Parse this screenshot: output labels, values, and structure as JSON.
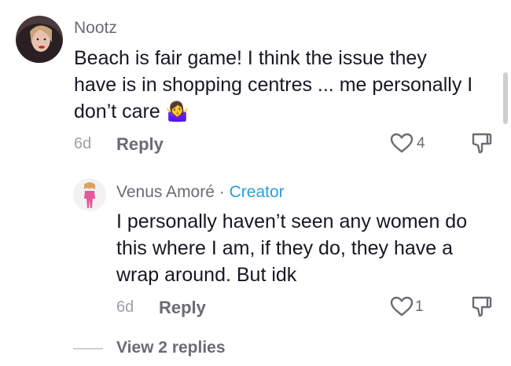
{
  "comment": {
    "username": "Nootz",
    "lines": [
      "Beach is fair game! I think the issue they",
      "have is in shopping centres ... me personally I",
      "don’t care"
    ],
    "emoji": "🤷‍♀️",
    "time": "6d",
    "reply_label": "Reply",
    "likes": "4",
    "icons": {
      "like": "heart-outline-icon",
      "dislike": "thumb-down-outline-icon"
    }
  },
  "reply": {
    "username": "Venus Amoré",
    "separator": "·",
    "badge": "Creator",
    "lines": [
      "I personally haven’t seen any women do",
      "this where I am, if they do, they have a",
      "wrap around. But idk"
    ],
    "time": "6d",
    "reply_label": "Reply",
    "likes": "1"
  },
  "view_replies": "View 2 replies",
  "colors": {
    "creator": "#2a9fd8",
    "text": "#161823",
    "muted": "#6b6b73"
  }
}
